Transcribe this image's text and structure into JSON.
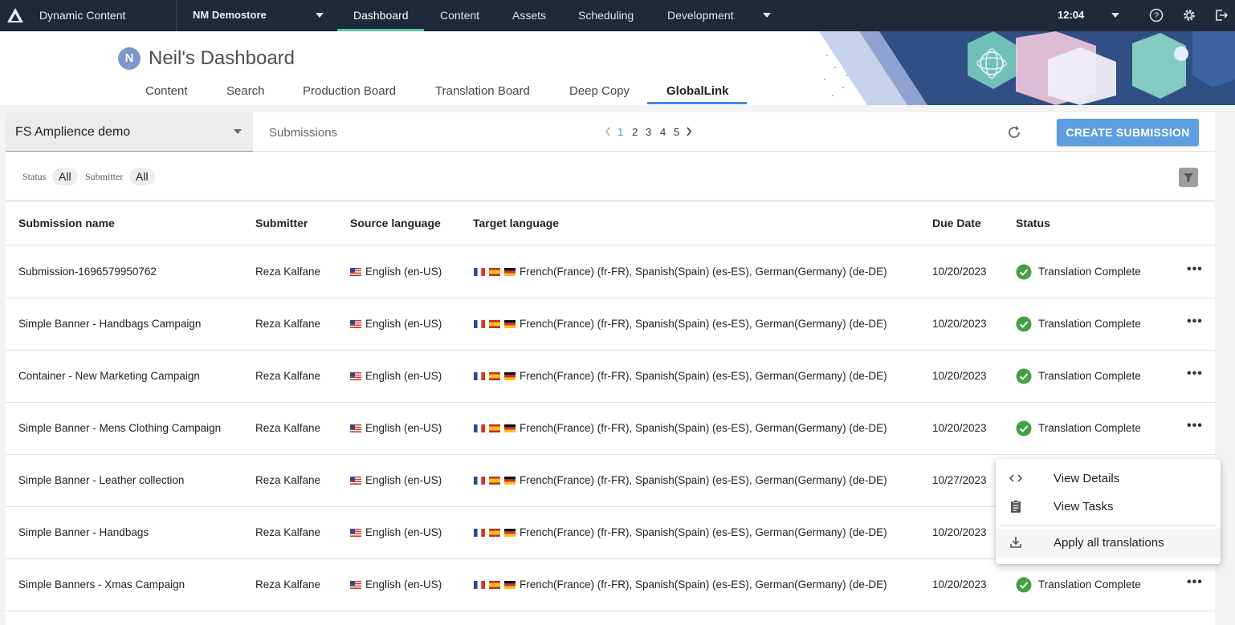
{
  "topbar": {
    "app_name": "Dynamic Content",
    "hub": "NM Demostore",
    "nav": [
      "Dashboard",
      "Content",
      "Assets",
      "Scheduling",
      "Development"
    ],
    "active_nav": "Dashboard",
    "time": "12:04",
    "icons": [
      "amplience-logo-icon",
      "help-icon",
      "settings-icon",
      "logout-icon"
    ]
  },
  "dashboard": {
    "avatar_initial": "N",
    "title": "Neil's Dashboard",
    "tabs": [
      "Content",
      "Search",
      "Production Board",
      "Translation Board",
      "Deep Copy",
      "GlobalLink"
    ],
    "active_tab": "GlobalLink"
  },
  "toolbar": {
    "hub_select_value": "FS Amplience demo",
    "submissions_label": "Submissions",
    "pages": [
      "1",
      "2",
      "3",
      "4",
      "5"
    ],
    "current_page": "1",
    "create_button": "CREATE SUBMISSION"
  },
  "filters": {
    "status_label": "Status",
    "status_value": "All",
    "submitter_label": "Submitter",
    "submitter_value": "All"
  },
  "table": {
    "columns": [
      "Submission name",
      "Submitter",
      "Source language",
      "Target language",
      "Due Date",
      "Status"
    ],
    "rows": [
      {
        "name": "Submission-1696579950762",
        "submitter": "Reza Kalfane",
        "source": "English (en-US)",
        "target": "French(France) (fr-FR), Spanish(Spain) (es-ES), German(Germany) (de-DE)",
        "due": "10/20/2023",
        "status": "Translation Complete"
      },
      {
        "name": "Simple Banner - Handbags Campaign",
        "submitter": "Reza Kalfane",
        "source": "English (en-US)",
        "target": "French(France) (fr-FR), Spanish(Spain) (es-ES), German(Germany) (de-DE)",
        "due": "10/20/2023",
        "status": "Translation Complete"
      },
      {
        "name": "Container - New Marketing Campaign",
        "submitter": "Reza Kalfane",
        "source": "English (en-US)",
        "target": "French(France) (fr-FR), Spanish(Spain) (es-ES), German(Germany) (de-DE)",
        "due": "10/20/2023",
        "status": "Translation Complete"
      },
      {
        "name": "Simple Banner - Mens Clothing Campaign",
        "submitter": "Reza Kalfane",
        "source": "English (en-US)",
        "target": "French(France) (fr-FR), Spanish(Spain) (es-ES), German(Germany) (de-DE)",
        "due": "10/20/2023",
        "status": "Translation Complete"
      },
      {
        "name": "Simple Banner - Leather collection",
        "submitter": "Reza Kalfane",
        "source": "English (en-US)",
        "target": "French(France) (fr-FR), Spanish(Spain) (es-ES), German(Germany) (de-DE)",
        "due": "10/27/2023",
        "status": ""
      },
      {
        "name": "Simple Banner - Handbags",
        "submitter": "Reza Kalfane",
        "source": "English (en-US)",
        "target": "French(France) (fr-FR), Spanish(Spain) (es-ES), German(Germany) (de-DE)",
        "due": "10/20/2023",
        "status": ""
      },
      {
        "name": "Simple Banners - Xmas Campaign",
        "submitter": "Reza Kalfane",
        "source": "English (en-US)",
        "target": "French(France) (fr-FR), Spanish(Spain) (es-ES), German(Germany) (de-DE)",
        "due": "10/20/2023",
        "status": "Translation Complete"
      }
    ]
  },
  "context_menu": {
    "items": [
      {
        "label": "View Details",
        "icon": "code-icon"
      },
      {
        "label": "View Tasks",
        "icon": "clipboard-icon"
      },
      {
        "label": "Apply all translations",
        "icon": "download-icon"
      }
    ]
  },
  "colors": {
    "topbar": "#1e2a3a",
    "nav_active_underline": "#5ec4a8",
    "tab_active_underline": "#3f8fd8",
    "create_button": "#5c9ee0",
    "status_complete": "#43a047"
  }
}
